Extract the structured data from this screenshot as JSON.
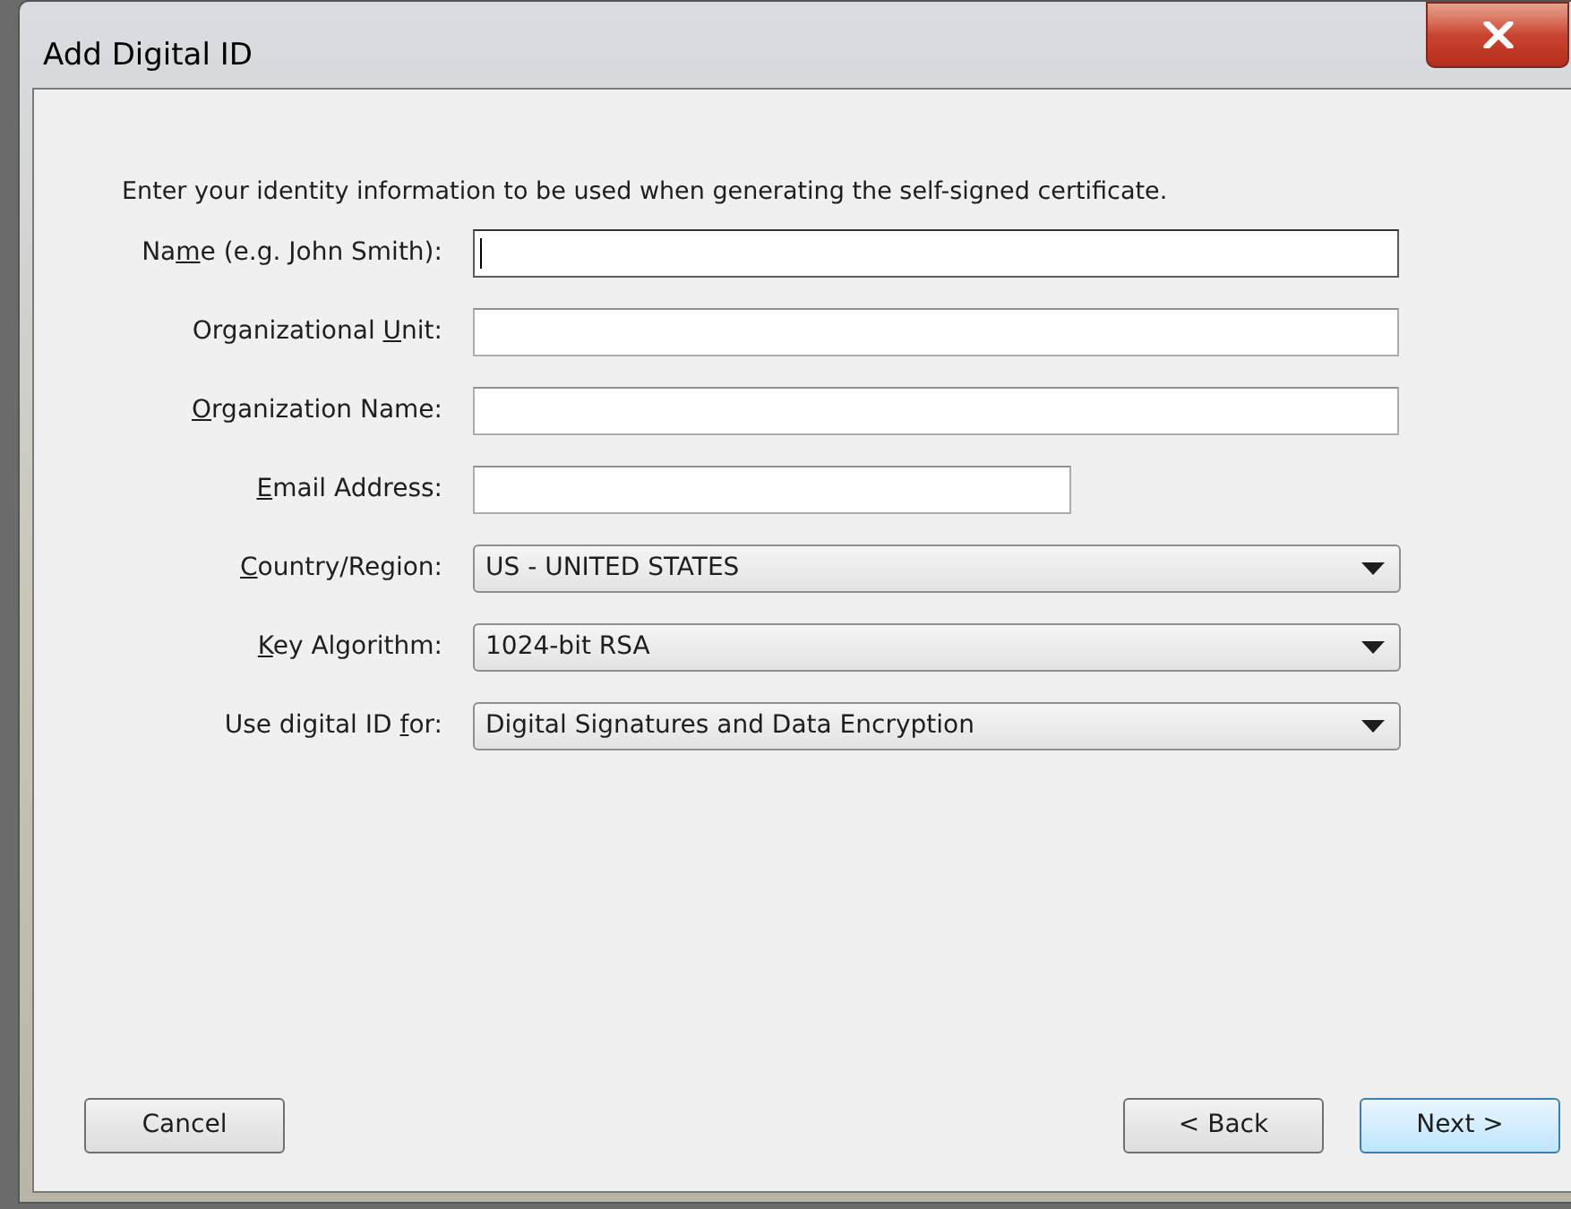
{
  "window": {
    "title": "Add Digital ID"
  },
  "instructions": "Enter your identity information to be used when generating the self-signed certificate.",
  "fields": [
    {
      "kind": "text",
      "label": {
        "before": "Na",
        "key": "m",
        "after": "e (e.g. John Smith):"
      },
      "focused": true
    },
    {
      "kind": "text",
      "label": {
        "before": "Organizational ",
        "key": "U",
        "after": "nit:"
      },
      "focused": false
    },
    {
      "kind": "text",
      "label": {
        "key": "O",
        "after": "rganization Name:"
      },
      "focused": false
    },
    {
      "kind": "short_text",
      "label": {
        "key": "E",
        "after": "mail Address:"
      },
      "focused": false
    },
    {
      "kind": "select",
      "label": {
        "key": "C",
        "after": "ountry/Region:"
      },
      "value": "US - UNITED STATES"
    },
    {
      "kind": "select",
      "label": {
        "key": "K",
        "after": "ey Algorithm:"
      },
      "value": "1024-bit RSA"
    },
    {
      "kind": "select",
      "label": {
        "before": "Use digital ID ",
        "key": "f",
        "after": "or:"
      },
      "value": "Digital Signatures and Data Encryption"
    }
  ],
  "buttons": [
    {
      "label": "Cancel",
      "default": false
    },
    {
      "label": "< Back",
      "default": false
    },
    {
      "label": "Next >",
      "default": true
    }
  ]
}
